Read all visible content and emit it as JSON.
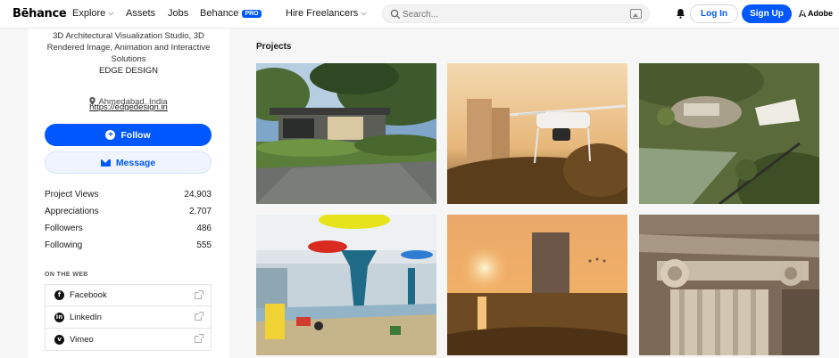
{
  "header": {
    "logo": "Bēhance",
    "nav": {
      "explore": "Explore",
      "assets": "Assets",
      "jobs": "Jobs",
      "behance": "Behance",
      "pro_badge": "PRO",
      "hire": "Hire Freelancers"
    },
    "search_placeholder": "Search...",
    "login": "Log In",
    "signup": "Sign Up",
    "adobe": "Adobe"
  },
  "profile": {
    "bio_lines": [
      "3D Architectural Visualization Studio, 3D",
      "Rendered Image, Animation and Interactive",
      "Solutions"
    ],
    "brand": "EDGE DESIGN",
    "website": "https://edgedesign.in",
    "location": "Ahmedabad, India",
    "follow_label": "Follow",
    "message_label": "Message",
    "stats": [
      {
        "label": "Project Views",
        "value": "24,903"
      },
      {
        "label": "Appreciations",
        "value": "2,707"
      },
      {
        "label": "Followers",
        "value": "486"
      },
      {
        "label": "Following",
        "value": "555"
      }
    ],
    "on_the_web_title": "ON THE WEB",
    "web_links": [
      {
        "label": "Facebook",
        "icon": "facebook-icon"
      },
      {
        "label": "LinkedIn",
        "icon": "linkedin-icon"
      },
      {
        "label": "Vimeo",
        "icon": "vimeo-icon"
      }
    ]
  },
  "main": {
    "projects_title": "Projects",
    "projects": [
      {
        "scene": "modern-villa-garden-render"
      },
      {
        "scene": "drone-over-tower-sunset"
      },
      {
        "scene": "aerial-resort-masterplan"
      },
      {
        "scene": "kids-play-area-interior"
      },
      {
        "scene": "tower-sunset-water-reflection"
      },
      {
        "scene": "ionic-column-capital-detail"
      }
    ]
  },
  "colors": {
    "accent": "#0057ff",
    "message_bg": "#f0f4ff",
    "page_bg": "#f6f6f6"
  }
}
